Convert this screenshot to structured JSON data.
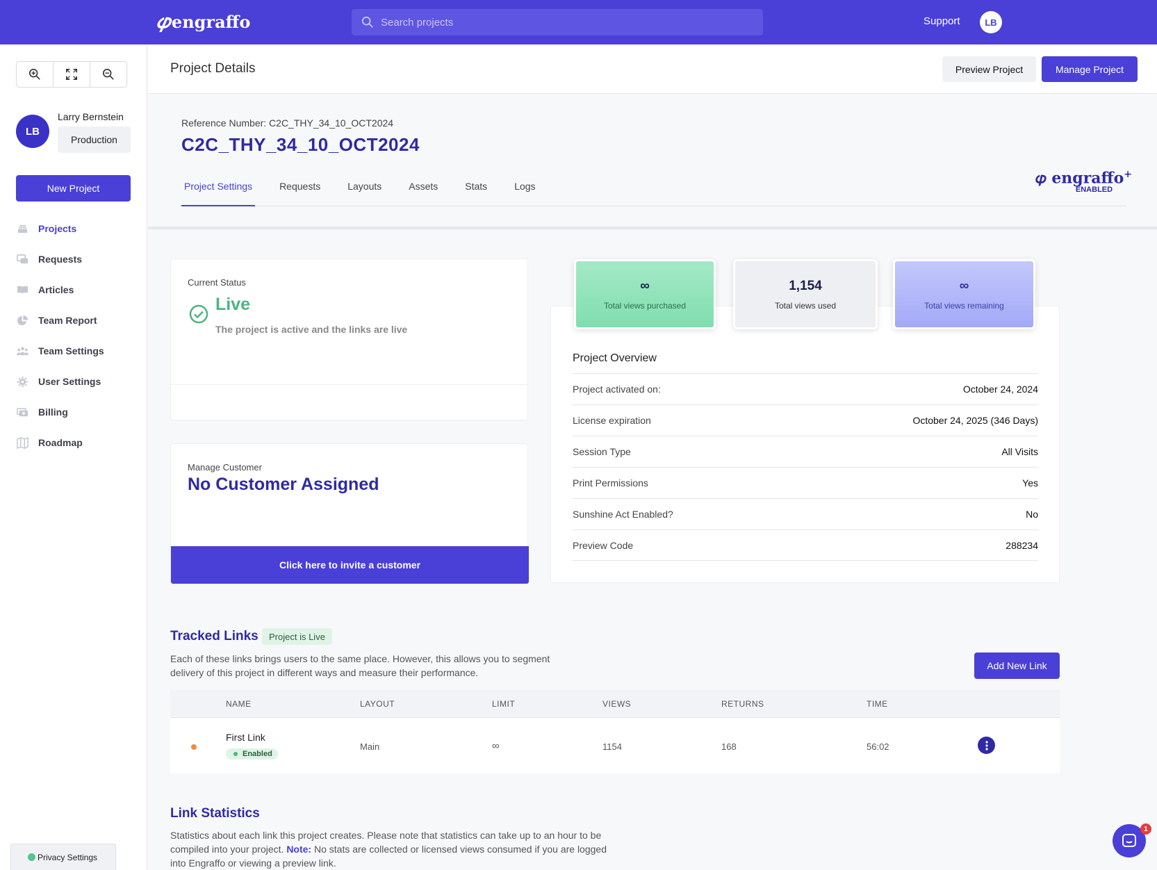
{
  "topbar": {
    "brand": "engraffo",
    "search_placeholder": "Search projects",
    "support_label": "Support",
    "avatar_initials": "LB"
  },
  "sidebar": {
    "user": {
      "initials": "LB",
      "name": "Larry Bernstein",
      "environment": "Production"
    },
    "new_project_label": "New Project",
    "nav": [
      {
        "label": "Projects",
        "icon": "projects-icon",
        "active": true
      },
      {
        "label": "Requests",
        "icon": "requests-icon"
      },
      {
        "label": "Articles",
        "icon": "articles-icon"
      },
      {
        "label": "Team Report",
        "icon": "team-report-icon"
      },
      {
        "label": "Team Settings",
        "icon": "team-settings-icon"
      },
      {
        "label": "User Settings",
        "icon": "user-settings-icon"
      },
      {
        "label": "Billing",
        "icon": "billing-icon"
      },
      {
        "label": "Roadmap",
        "icon": "roadmap-icon"
      }
    ],
    "privacy_label": "Privacy Settings"
  },
  "header": {
    "title": "Project Details",
    "preview_label": "Preview Project",
    "manage_label": "Manage Project"
  },
  "project": {
    "reference_label": "Reference Number: C2C_THY_34_10_OCT2024",
    "reference": "C2C_THY_34_10_OCT2024",
    "tabs": [
      "Project Settings",
      "Requests",
      "Layouts",
      "Assets",
      "Stats",
      "Logs"
    ],
    "brand_plus_name": "engraffo",
    "brand_plus_sup": "+",
    "brand_plus_status": "ENABLED"
  },
  "status": {
    "label": "Current Status",
    "value": "Live",
    "description": "The project is active and the links are live"
  },
  "customer": {
    "label": "Manage Customer",
    "value": "No Customer Assigned",
    "invite_label": "Click here to invite a customer"
  },
  "metrics": [
    {
      "value": "∞",
      "label": "Total views purchased"
    },
    {
      "value": "1,154",
      "label": "Total views used"
    },
    {
      "value": "∞",
      "label": "Total views remaining"
    }
  ],
  "overview": {
    "title": "Project Overview",
    "rows": [
      {
        "key": "Project activated on:",
        "value": "October 24, 2024"
      },
      {
        "key": "License expiration",
        "value": "October 24, 2025 (346 Days)"
      },
      {
        "key": "Session Type",
        "value": "All Visits"
      },
      {
        "key": "Print Permissions",
        "value": "Yes"
      },
      {
        "key": "Sunshine Act Enabled?",
        "value": "No"
      },
      {
        "key": "Preview Code",
        "value": "288234"
      }
    ]
  },
  "tracked_links": {
    "title": "Tracked Links",
    "badge": "Project is Live",
    "description": "Each of these links brings users to the same place. However, this allows you to segment delivery of this project in different ways and measure their performance.",
    "add_label": "Add New Link",
    "columns": [
      "NAME",
      "LAYOUT",
      "LIMIT",
      "VIEWS",
      "RETURNS",
      "TIME"
    ],
    "rows": [
      {
        "name": "First Link",
        "status": "Enabled",
        "layout": "Main",
        "limit": "∞",
        "views": "1154",
        "returns": "168",
        "time": "56:02"
      }
    ]
  },
  "link_statistics": {
    "title": "Link Statistics",
    "description_a": "Statistics about each link this project creates. Please note that statistics can take up to an hour to be compiled into your project. ",
    "note_label": "Note:",
    "description_b": " No stats are collected or licensed views consumed if you are logged into Engraffo or viewing a preview link."
  },
  "chat": {
    "badge_count": "1"
  },
  "colors": {
    "primary": "#4a3fd6",
    "heading": "#2e2aa4",
    "live": "#4bb57f"
  }
}
